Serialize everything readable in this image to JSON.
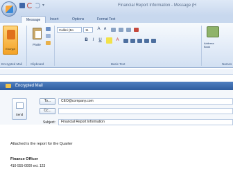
{
  "window": {
    "title": "Financial Report Information - Message (H"
  },
  "tabs": [
    {
      "label": "Message"
    },
    {
      "label": "Insert"
    },
    {
      "label": "Options"
    },
    {
      "label": "Format Text"
    }
  ],
  "ribbon": {
    "encrypt_label": "Encrypt",
    "paste_label": "Paste",
    "font_name": "Calibri (Bo",
    "font_size": "11",
    "address_label_line1": "Address",
    "address_label_line2": "Book",
    "groups": {
      "encrypted_mail": "Encrypted Mail",
      "clipboard": "Clipboard",
      "basic_text": "Basic Text",
      "names": "Names"
    }
  },
  "encryption_banner": {
    "text": "Encrypted Mail"
  },
  "compose": {
    "send_label": "Send",
    "to_button": "To...",
    "cc_button": "Cc...",
    "subject_label": "Subject:",
    "to_value": "CEO@company.com",
    "cc_value": "",
    "subject_value": "Financial Report Information"
  },
  "message_body": {
    "line1": "Attached is the report for the Quarter",
    "signature_title": "Finance Officer",
    "signature_phone": "410-555-0000 ext. 123"
  }
}
